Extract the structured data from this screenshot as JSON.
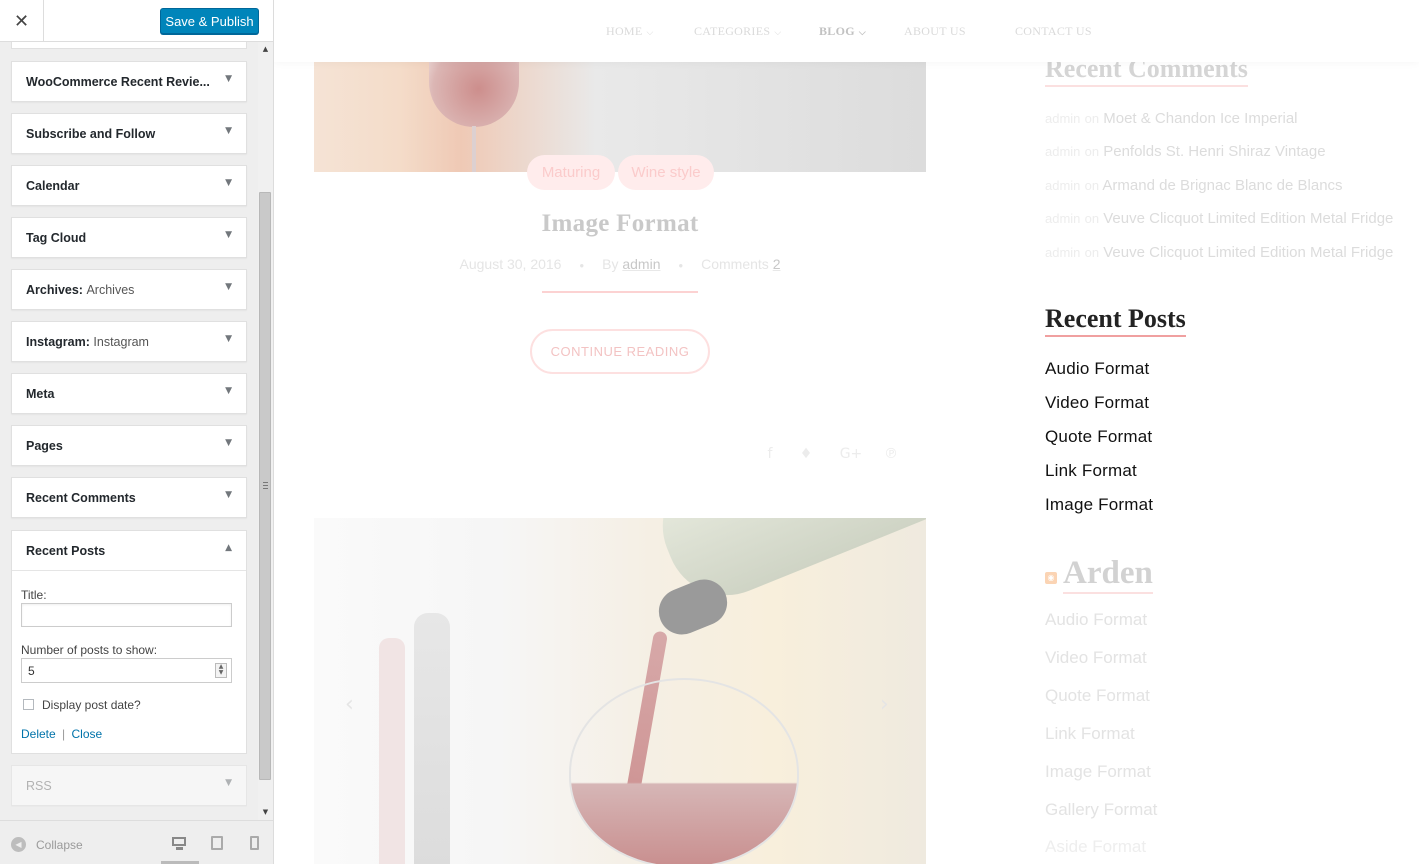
{
  "customizer": {
    "close_label": "✕",
    "save_label": "Save & Publish",
    "widgets": [
      {
        "title": "WooCommerce Recent Revie...",
        "subtitle": ""
      },
      {
        "title": "Subscribe and Follow",
        "subtitle": ""
      },
      {
        "title": "Calendar",
        "subtitle": ""
      },
      {
        "title": "Tag Cloud",
        "subtitle": ""
      },
      {
        "title": "Archives:",
        "subtitle": "Archives"
      },
      {
        "title": "Instagram:",
        "subtitle": "Instagram"
      },
      {
        "title": "Meta",
        "subtitle": ""
      },
      {
        "title": "Pages",
        "subtitle": ""
      },
      {
        "title": "Recent Comments",
        "subtitle": ""
      }
    ],
    "recent_posts_widget": {
      "title": "Recent Posts",
      "title_label": "Title:",
      "title_value": "",
      "number_label": "Number of posts to show:",
      "number_value": "5",
      "display_date_label": "Display post date?",
      "display_date_checked": false,
      "delete_label": "Delete",
      "link_separator": "|",
      "close_label": "Close"
    },
    "rss_widget": {
      "title": "RSS"
    },
    "collapse_label": "Collapse",
    "devices": [
      "desktop",
      "tablet",
      "mobile"
    ],
    "active_device": "desktop",
    "accent_color": "#0085ba"
  },
  "preview": {
    "nav": [
      {
        "label": "HOME",
        "has_dropdown": true,
        "active": false
      },
      {
        "label": "CATEGORIES",
        "has_dropdown": true,
        "active": false
      },
      {
        "label": "BLOG",
        "has_dropdown": true,
        "active": true
      },
      {
        "label": "ABOUT US",
        "has_dropdown": false,
        "active": false
      },
      {
        "label": "CONTACT US",
        "has_dropdown": false,
        "active": false
      }
    ],
    "post": {
      "tags": [
        "Maturing",
        "Wine style"
      ],
      "title": "Image Format",
      "date": "August 30, 2016",
      "by_label": "By",
      "author": "admin",
      "comments_label": "Comments",
      "comments_count": "2",
      "continue_label": "CONTINUE READING",
      "share_icons": [
        "facebook-icon",
        "twitter-icon",
        "google-plus-icon",
        "pinterest-icon"
      ]
    },
    "sidebar": {
      "recent_comments": {
        "heading": "Recent Comments",
        "items": [
          {
            "author": "admin",
            "on": "on",
            "post": "Moet & Chandon Ice Imperial"
          },
          {
            "author": "admin",
            "on": "on",
            "post": "Penfolds St. Henri Shiraz Vintage"
          },
          {
            "author": "admin",
            "on": "on",
            "post": "Armand de Brignac Blanc de Blancs"
          },
          {
            "author": "admin",
            "on": "on",
            "post": "Veuve Clicquot Limited Edition Metal Fridge"
          },
          {
            "author": "admin",
            "on": "on",
            "post": "Veuve Clicquot Limited Edition Metal Fridge"
          }
        ]
      },
      "recent_posts": {
        "heading": "Recent Posts",
        "items": [
          "Audio Format",
          "Video Format",
          "Quote Format",
          "Link Format",
          "Image Format"
        ]
      },
      "rss": {
        "heading": "Arden",
        "items": [
          "Audio Format",
          "Video Format",
          "Quote Format",
          "Link Format",
          "Image Format",
          "Gallery Format",
          "Aside Format"
        ]
      }
    }
  }
}
